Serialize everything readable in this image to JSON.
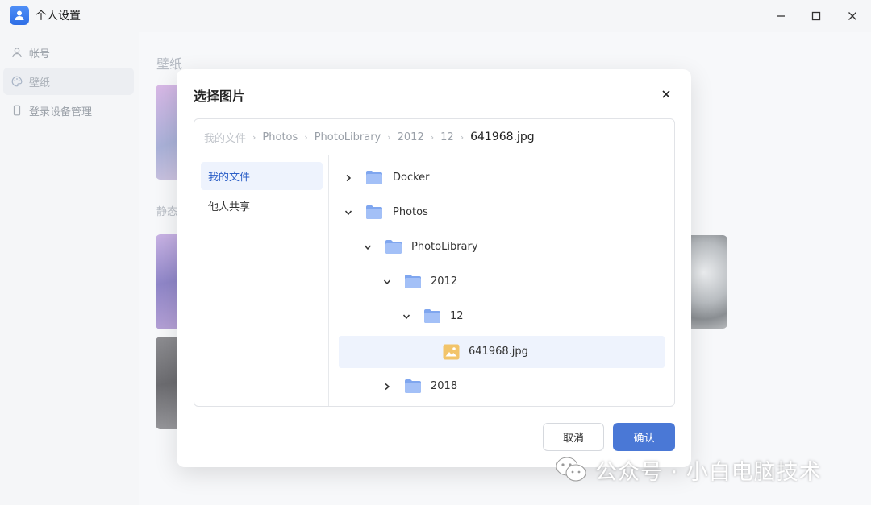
{
  "window": {
    "title": "个人设置"
  },
  "sidebar": {
    "items": [
      {
        "label": "帐号",
        "icon": "user-icon"
      },
      {
        "label": "壁纸",
        "icon": "palette-icon"
      },
      {
        "label": "登录设备管理",
        "icon": "device-icon"
      }
    ]
  },
  "main": {
    "title": "壁纸",
    "section_label": "静态"
  },
  "dialog": {
    "title": "选择图片",
    "breadcrumb": [
      "我的文件",
      "Photos",
      "PhotoLibrary",
      "2012",
      "12",
      "641968.jpg"
    ],
    "nav": [
      "我的文件",
      "他人共享"
    ],
    "tree": [
      {
        "label": "Docker",
        "depth": 0,
        "expanded": false,
        "type": "folder"
      },
      {
        "label": "Photos",
        "depth": 0,
        "expanded": true,
        "type": "folder"
      },
      {
        "label": "PhotoLibrary",
        "depth": 1,
        "expanded": true,
        "type": "folder"
      },
      {
        "label": "2012",
        "depth": 2,
        "expanded": true,
        "type": "folder"
      },
      {
        "label": "12",
        "depth": 3,
        "expanded": true,
        "type": "folder"
      },
      {
        "label": "641968.jpg",
        "depth": 4,
        "type": "image",
        "selected": true
      },
      {
        "label": "2018",
        "depth": 2,
        "expanded": false,
        "type": "folder"
      }
    ],
    "cancel_label": "取消",
    "confirm_label": "确认"
  },
  "watermark": {
    "text": "公众号 · 小白电脑技术"
  },
  "colors": {
    "accent": "#4a78d6",
    "selected_bg": "#eef3fd",
    "folder": "#8fb3f5",
    "image_file": "#f2c46a"
  }
}
